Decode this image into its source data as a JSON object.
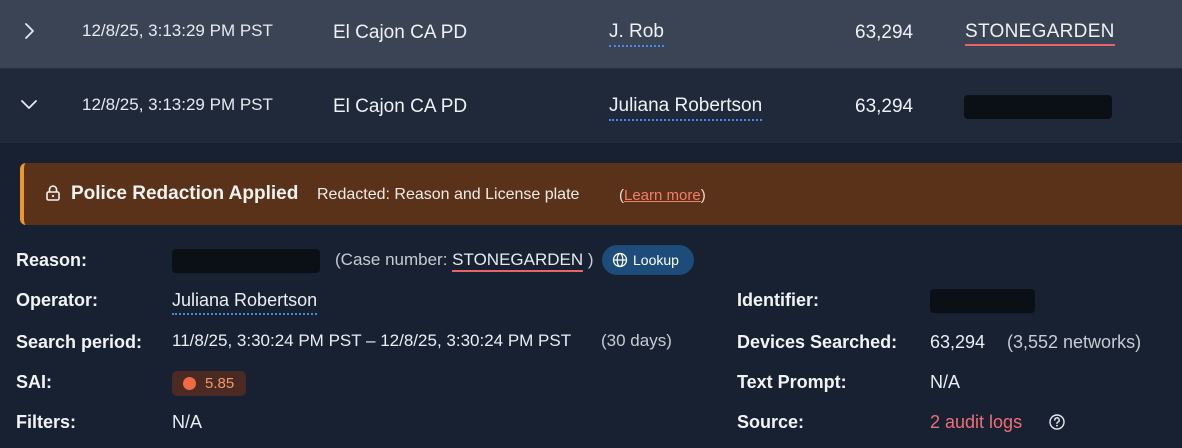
{
  "rows": [
    {
      "expanded": false,
      "timestamp": "12/8/25, 3:13:29 PM PST",
      "agency": "El Cajon CA PD",
      "user": "J. Rob",
      "devices": "63,294",
      "case": "STONEGARDEN"
    },
    {
      "expanded": true,
      "timestamp": "12/8/25, 3:13:29 PM PST",
      "agency": "El Cajon CA PD",
      "user": "Juliana Robertson",
      "devices": "63,294",
      "case_redacted": true
    }
  ],
  "banner": {
    "title": "Police Redaction Applied",
    "description": "Redacted: Reason and License plate",
    "learn_open": "(",
    "learn_more": "Learn more",
    "learn_close": ")",
    "accent_color": "#f0962e"
  },
  "details": {
    "reason_label": "Reason:",
    "case_prefix": "(Case number: ",
    "case_number": "STONEGARDEN",
    "case_suffix": " )",
    "lookup_label": "Lookup",
    "operator_label": "Operator:",
    "operator_value": "Juliana Robertson",
    "search_period_label": "Search period:",
    "search_period_value": "11/8/25, 3:30:24 PM PST – 12/8/25, 3:30:24 PM PST",
    "search_period_days": "(30 days)",
    "sai_label": "SAI:",
    "sai_value": "5.85",
    "filters_label": "Filters:",
    "filters_value": "N/A",
    "identifier_label": "Identifier:",
    "devices_label": "Devices Searched:",
    "devices_value": "63,294",
    "networks_value": "(3,552 networks)",
    "text_prompt_label": "Text Prompt:",
    "text_prompt_value": "N/A",
    "source_label": "Source:",
    "source_value": "2 audit logs"
  },
  "icons": {
    "row1_toggle": "chevron-right-icon",
    "row2_toggle": "chevron-down-icon",
    "banner": "lock-icon",
    "lookup": "globe-icon",
    "source_help": "help-circle-icon"
  },
  "colors": {
    "link_underline": "#4a86e8",
    "case_underline": "#e8646b",
    "audit_link": "#f07077",
    "sai_dot": "#f06b45"
  }
}
